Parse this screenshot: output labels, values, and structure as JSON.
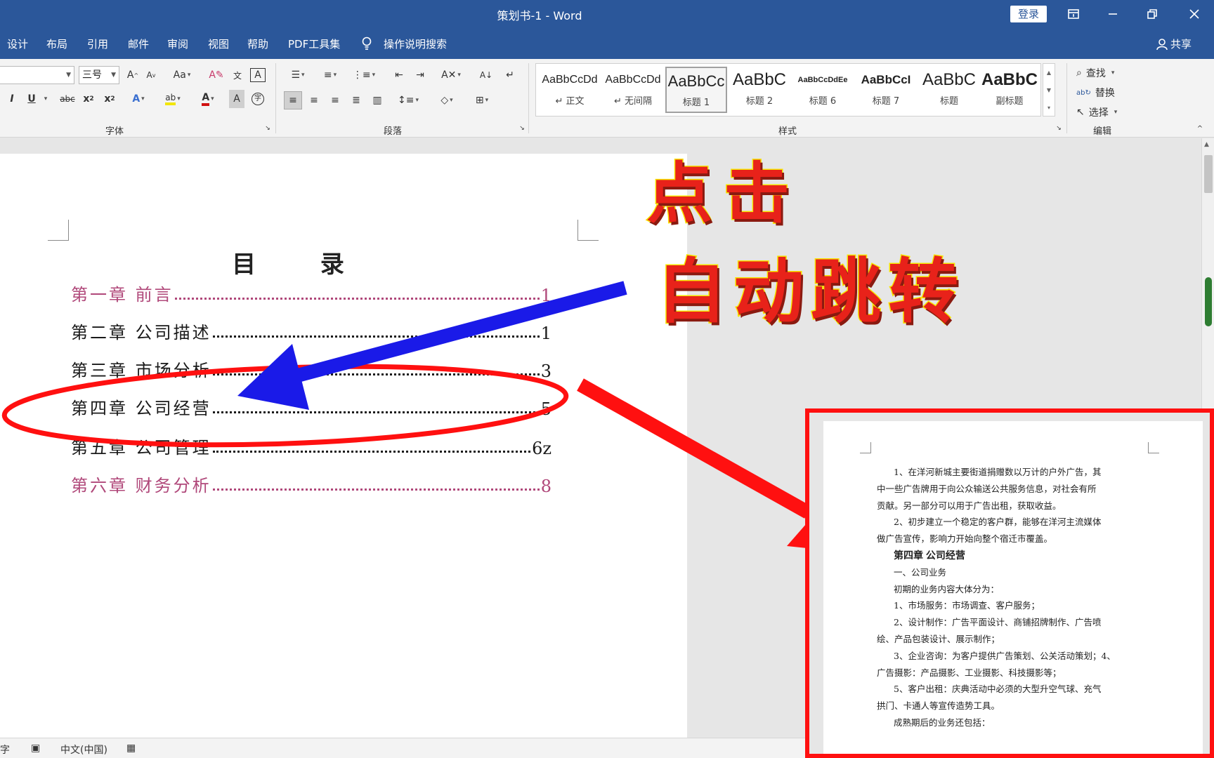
{
  "window": {
    "title": "策划书-1  -  Word",
    "login_label": "登录"
  },
  "menu": {
    "tabs": [
      "设计",
      "布局",
      "引用",
      "邮件",
      "审阅",
      "视图",
      "帮助",
      "PDF工具集"
    ],
    "search_label": "操作说明搜索",
    "share_label": "共享"
  },
  "ribbon": {
    "font_name": "",
    "font_size": "三号",
    "groups": {
      "font": "字体",
      "paragraph": "段落",
      "styles": "样式",
      "edit": "编辑"
    },
    "styles": [
      {
        "sample": "AaBbCcDd",
        "name": "↵ 正文"
      },
      {
        "sample": "AaBbCcDd",
        "name": "↵ 无间隔"
      },
      {
        "sample": "AaBbCc",
        "name": "标题 1"
      },
      {
        "sample": "AaBbC",
        "name": "标题 2"
      },
      {
        "sample": "AaBbCcDdEe",
        "name": "标题 6"
      },
      {
        "sample": "AaBbCcI",
        "name": "标题 7"
      },
      {
        "sample": "AaBbC",
        "name": "标题"
      },
      {
        "sample": "AaBbC",
        "name": "副标题"
      }
    ],
    "edit": {
      "find": "查找",
      "replace": "替换",
      "select": "选择"
    }
  },
  "document": {
    "toc_title": "目 录",
    "toc": [
      {
        "title": "第一章  前言",
        "page": "1",
        "highlight": true
      },
      {
        "title": "第二章  公司描述",
        "page": "1",
        "highlight": false
      },
      {
        "title": "第三章  市场分析",
        "page": "3",
        "highlight": false
      },
      {
        "title": "第四章  公司经营",
        "page": "5",
        "highlight": false
      },
      {
        "title": "第五章  公司管理",
        "page": "6z",
        "highlight": false
      },
      {
        "title": "第六章  财务分析",
        "page": "8",
        "highlight": true
      }
    ]
  },
  "annotation": {
    "click": "点击",
    "auto_jump": "自动跳转",
    "colors": {
      "text": "#e8221a",
      "outline": "#f7e400",
      "arrow_red": "#ff1010",
      "arrow_blue": "#1a1ae8"
    }
  },
  "inset": {
    "lines": [
      "1、在洋河新城主要街道捐赠数以万计的户外广告，其",
      "中一些广告牌用于向公众输送公共服务信息，对社会有所",
      "贡献。另一部分可以用于广告出租，获取收益。",
      "2、初步建立一个稳定的客户群，能够在洋河主流媒体",
      "做广告宣传，影响力开始向整个宿迁市覆盖。",
      "第四章 公司经营",
      "一、公司业务",
      "初期的业务内容大体分为：",
      "1、市场服务：市场调查、客户服务；",
      "2、设计制作：广告平面设计、商铺招牌制作、广告喷",
      "绘、产品包装设计、展示制作；",
      "3、企业咨询：为客户提供广告策划、公关活动策划；4、",
      "广告摄影：产品摄影、工业摄影、科技摄影等；",
      "5、客户出租：庆典活动中必须的大型升空气球、充气",
      "拱门、卡通人等宣传造势工具。",
      "成熟期后的业务还包括："
    ]
  },
  "status": {
    "words": "字",
    "language": "中文(中国)"
  }
}
